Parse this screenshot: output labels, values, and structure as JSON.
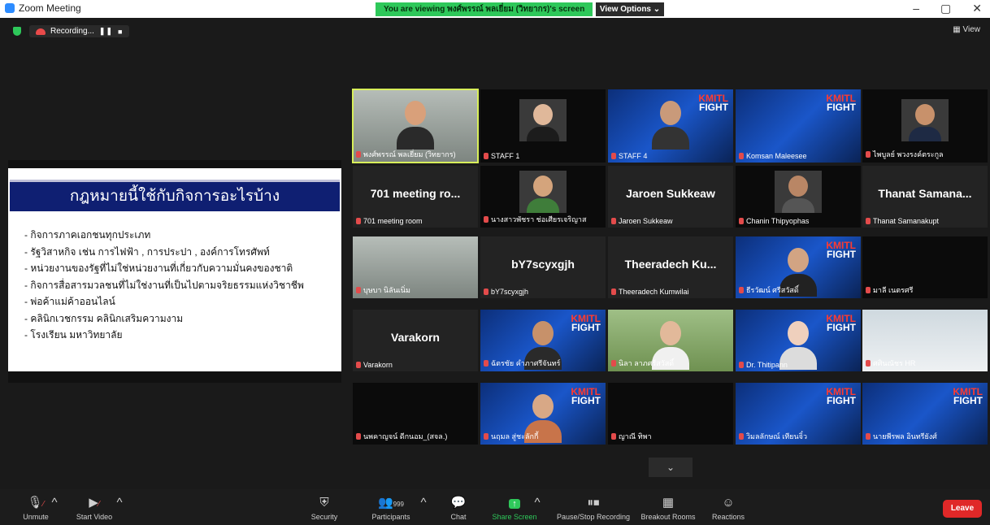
{
  "window": {
    "title": "Zoom Meeting",
    "minimize": "–",
    "restore": "▢",
    "close": "✕"
  },
  "banner": {
    "viewing_text": "You are viewing พงศ์พรรณ์ พลเยี่ยม (วิทยากร)'s screen",
    "view_options": "View Options ⌄"
  },
  "top": {
    "recording_label": "Recording...",
    "pause": "❚❚",
    "stop": "■",
    "view_label": "View"
  },
  "slide": {
    "title": "กฎหมายนี้ใช้กับกิจการอะไรบ้าง",
    "items": [
      "-  กิจการภาคเอกชนทุกประเภท",
      "-  รัฐวิสาหกิจ เช่น การไฟฟ้า , การประปา , องค์การโทรศัพท์",
      "-  หน่วยงานของรัฐที่ไม่ใช่หน่วยงานที่เกี่ยวกับความมั่นคงของชาติ",
      "-  กิจการสื่อสารมวลชนที่ไม่ใช่งานที่เป็นไปตามจริยธรรมแห่งวิชาชีพ",
      "-  พ่อค้าแม่ค้าออนไลน์",
      "-  คลินิกเวชกรรม คลินิกเสริมความงาม",
      "-  โรงเรียน มหาวิทยาลัย"
    ]
  },
  "participants": [
    {
      "name": "พงศ์พรรณ์ พลเยี่ยม (วิทยากร)",
      "big": "",
      "bg": "bg-office",
      "active": true,
      "kind": "person",
      "skin": "#d9a07a",
      "shirt": "#2a2a2a"
    },
    {
      "name": "STAFF 1",
      "big": "",
      "bg": "bg-black",
      "kind": "photo",
      "skin": "#e0b89a",
      "shirt": "#1c1c1c"
    },
    {
      "name": "STAFF 4",
      "big": "",
      "bg": "bg-kmitl",
      "kind": "person",
      "skin": "#c99a7a",
      "shirt": "#333"
    },
    {
      "name": "Komsan Maleesee",
      "big": "",
      "bg": "bg-kmitl",
      "kind": "logo"
    },
    {
      "name": "ไพบูลย์ พวงรงค์ตระกูล",
      "big": "",
      "bg": "bg-black",
      "kind": "photo",
      "skin": "#c8916b",
      "shirt": "#1e2a44"
    },
    {
      "name": "701 meeting room",
      "big": "701 meeting ro...",
      "bg": "",
      "kind": "text"
    },
    {
      "name": "นางสาวพัชรา ช่อเศียรเจริญาส",
      "big": "",
      "bg": "bg-black",
      "kind": "photo",
      "skin": "#d4a47c",
      "shirt": "#3f7d3a"
    },
    {
      "name": "Jaroen Sukkeaw",
      "big": "Jaroen Sukkeaw",
      "bg": "",
      "kind": "text"
    },
    {
      "name": "Chanin Thipyophas",
      "big": "",
      "bg": "bg-black",
      "kind": "photo",
      "skin": "#b98665",
      "shirt": "#555"
    },
    {
      "name": "Thanat Samanakupt",
      "big": "Thanat Samana...",
      "bg": "",
      "kind": "text"
    },
    {
      "name": "บุษบา นิลันเนิ่ม",
      "big": "",
      "bg": "bg-office",
      "kind": "none"
    },
    {
      "name": "bY7scyxgjh",
      "big": "bY7scyxgjh",
      "bg": "",
      "kind": "text"
    },
    {
      "name": "Theeradech Kumwilai",
      "big": "Theeradech Ku...",
      "bg": "",
      "kind": "text"
    },
    {
      "name": "ธีรวัฒน์ ศรีสวัสดิ์",
      "big": "",
      "bg": "bg-kmitl",
      "kind": "person",
      "skin": "#d2a483",
      "shirt": "#222"
    },
    {
      "name": "มาลี เนตรศรี",
      "big": "",
      "bg": "bg-black",
      "kind": "none"
    },
    {
      "name": "Varakorn",
      "big": "Varakorn",
      "bg": "",
      "kind": "text"
    },
    {
      "name": "ฉัตรชัย คำภาศรีจันทร์",
      "big": "",
      "bg": "bg-kmitl",
      "kind": "person",
      "skin": "#c7916a",
      "shirt": "#2a2a2a"
    },
    {
      "name": "นิลา ลาภศรีสวัสดิ์",
      "big": "",
      "bg": "bg-out",
      "kind": "person",
      "skin": "#e2b99a",
      "shirt": "#f0f0f0"
    },
    {
      "name": "Dr. Thitipann",
      "big": "",
      "bg": "bg-kmitl",
      "kind": "person",
      "skin": "#efd0bd",
      "shirt": "#dcdcdc"
    },
    {
      "name": "ศศินณัชร HR",
      "big": "",
      "bg": "bg-light",
      "kind": "none"
    },
    {
      "name": "นพคาญจน์ ดีกนอม_(สจล.)",
      "big": "",
      "bg": "bg-black",
      "kind": "none"
    },
    {
      "name": "นฤมล สู่ชะลักกี้",
      "big": "",
      "bg": "bg-kmitl",
      "kind": "person",
      "skin": "#d8a886",
      "shirt": "#c8744a"
    },
    {
      "name": "ญาณี ทิพา",
      "big": "",
      "bg": "bg-black",
      "kind": "none"
    },
    {
      "name": "วิมลลักษณ์ เทียนจิ๋ว",
      "big": "",
      "bg": "bg-kmitl",
      "kind": "logo"
    },
    {
      "name": "นายพีรพล อินทรียังศ์",
      "big": "",
      "bg": "bg-kmitl",
      "kind": "logo"
    }
  ],
  "logo": {
    "line1": "KMITL",
    "line2": "FIGHT"
  },
  "toolbar": {
    "unmute": "Unmute",
    "start_video": "Start Video",
    "security": "Security",
    "participants": "Participants",
    "participant_count": "999",
    "chat": "Chat",
    "share_screen": "Share Screen",
    "pause_stop_recording": "Pause/Stop Recording",
    "breakout_rooms": "Breakout Rooms",
    "reactions": "Reactions",
    "leave": "Leave",
    "caret": "^",
    "chevron": "⌄"
  }
}
